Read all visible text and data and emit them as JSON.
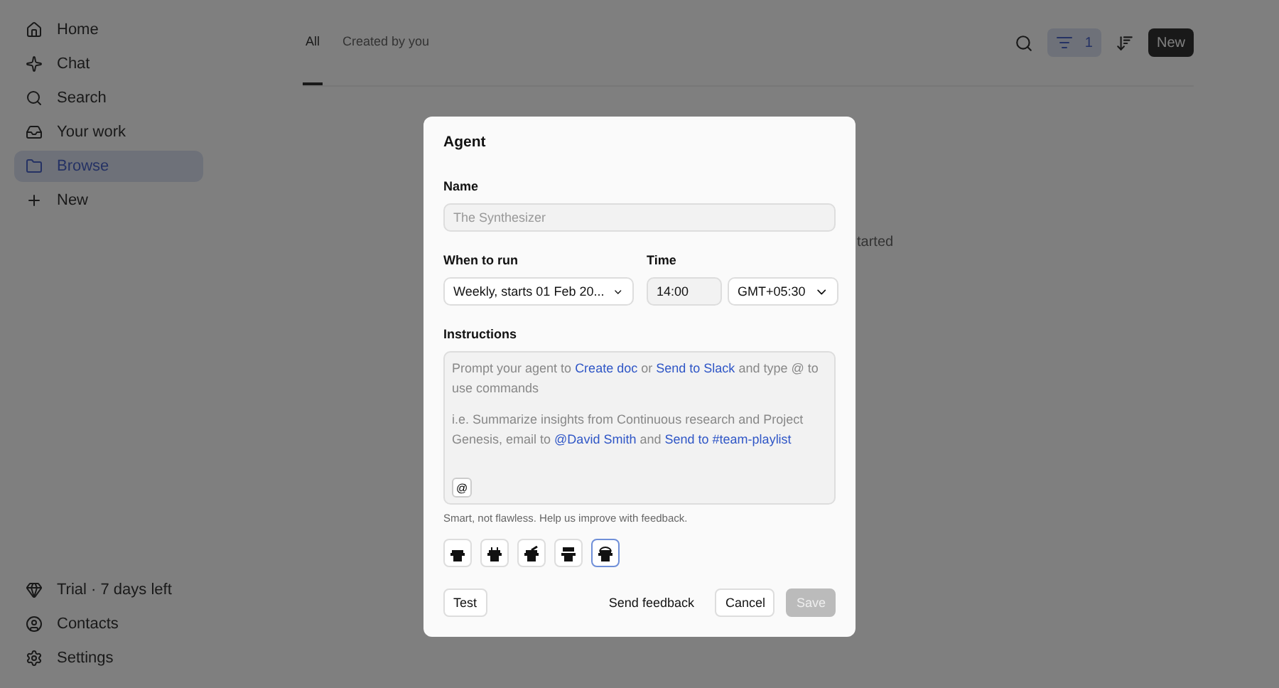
{
  "sidebar": {
    "items": [
      {
        "label": "Home",
        "selected": false
      },
      {
        "label": "Chat",
        "selected": false
      },
      {
        "label": "Search",
        "selected": false
      },
      {
        "label": "Your work",
        "selected": false
      },
      {
        "label": "Browse",
        "selected": true
      },
      {
        "label": "New",
        "selected": false
      }
    ],
    "bottom_items": [
      {
        "label": "Trial · 7 days left"
      },
      {
        "label": "Contacts"
      },
      {
        "label": "Settings"
      }
    ]
  },
  "tabs": [
    {
      "label": "All",
      "selected": true
    },
    {
      "label": "Created by you",
      "selected": false
    }
  ],
  "toolbar": {
    "filter_count": "1",
    "new_button": "New"
  },
  "background_text": "tarted",
  "dialog": {
    "title": "Agent",
    "name": {
      "label": "Name",
      "placeholder": "The Synthesizer"
    },
    "schedule": {
      "label": "When to run",
      "value": "Weekly, starts 01 Feb 20..."
    },
    "time": {
      "label": "Time",
      "value": "14:00",
      "timezone": "GMT+05:30"
    },
    "instructions": {
      "label": "Instructions",
      "paragraphs": [
        [
          {
            "kind": "text",
            "text": "Prompt your agent to"
          },
          {
            "kind": "link",
            "text": "Create doc"
          },
          {
            "kind": "text",
            "text": "or"
          },
          {
            "kind": "link",
            "text": "Send to Slack"
          },
          {
            "kind": "text",
            "text": "and type @ to use commands"
          }
        ],
        [
          {
            "kind": "text",
            "text": "i.e. Summarize insights from Continuous research and Project Genesis, email to"
          },
          {
            "kind": "link",
            "text": "@David Smith"
          },
          {
            "kind": "text",
            "text": "and"
          },
          {
            "kind": "link",
            "text": "Send to #team-playlist"
          }
        ]
      ],
      "mention_button": "@"
    },
    "hint": "Smart, not flawless. Help us improve with feedback.",
    "avatars": [
      {
        "selected": false
      },
      {
        "selected": false
      },
      {
        "selected": false
      },
      {
        "selected": false
      },
      {
        "selected": true
      }
    ],
    "buttons": {
      "test": "Test",
      "feedback": "Send feedback",
      "cancel": "Cancel",
      "save": "Save",
      "save_disabled": true
    }
  }
}
